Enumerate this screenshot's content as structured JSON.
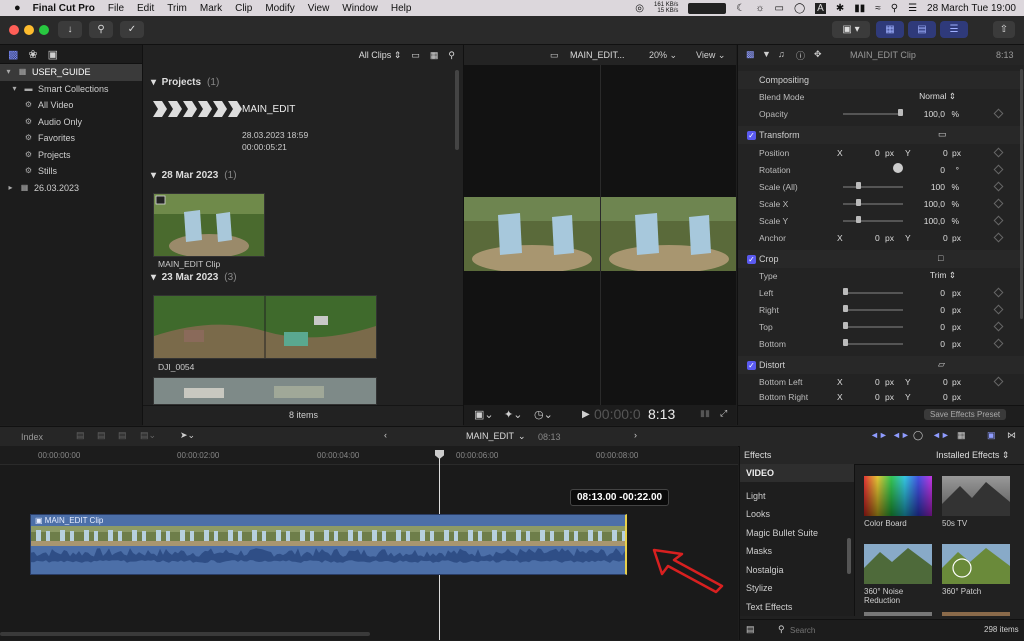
{
  "menubar": {
    "app_name": "Final Cut Pro",
    "menus": [
      "File",
      "Edit",
      "Trim",
      "Mark",
      "Clip",
      "Modify",
      "View",
      "Window",
      "Help"
    ],
    "net_up": "161 KB/s",
    "net_down": "15 KB/s",
    "date_time": "28 March Tue  19:00"
  },
  "library": {
    "items": [
      {
        "label": "USER_GUIDE",
        "icon": "library-icon"
      },
      {
        "label": "Smart Collections",
        "icon": "folder-icon"
      },
      {
        "label": "All Video",
        "icon": "smart-collection-icon"
      },
      {
        "label": "Audio Only",
        "icon": "smart-collection-icon"
      },
      {
        "label": "Favorites",
        "icon": "smart-collection-icon"
      },
      {
        "label": "Projects",
        "icon": "smart-collection-icon"
      },
      {
        "label": "Stills",
        "icon": "smart-collection-icon"
      },
      {
        "label": "26.03.2023",
        "icon": "event-icon"
      }
    ]
  },
  "browser": {
    "filter": "All Clips",
    "sections": [
      {
        "title": "Projects",
        "count": "(1)"
      },
      {
        "title": "28 Mar 2023",
        "count": "(1)"
      },
      {
        "title": "23 Mar 2023",
        "count": "(3)"
      }
    ],
    "project": {
      "name": "MAIN_EDIT",
      "date": "28.03.2023 18:59",
      "duration": "00:00:05:21"
    },
    "clips": [
      {
        "name": "MAIN_EDIT Clip"
      },
      {
        "name": "DJI_0054"
      }
    ],
    "item_count": "8 items"
  },
  "viewer": {
    "title": "MAIN_EDIT...",
    "zoom": "20%",
    "view_label": "View",
    "timecode_dim": "00:00:0",
    "timecode": "8:13"
  },
  "inspector": {
    "clip_name": "MAIN_EDIT Clip",
    "duration": "8:13",
    "compositing": "Compositing",
    "blend_mode_label": "Blend Mode",
    "blend_mode": "Normal",
    "opacity_label": "Opacity",
    "opacity": "100,0",
    "opacity_unit": "%",
    "transform": "Transform",
    "position_label": "Position",
    "rotation_label": "Rotation",
    "rotation": "0",
    "deg": "°",
    "scale_all_label": "Scale (All)",
    "scale_all": "100",
    "scale_x_label": "Scale X",
    "scale_x": "100,0",
    "scale_y_label": "Scale Y",
    "scale_y": "100,0",
    "anchor_label": "Anchor",
    "x": "X",
    "y": "Y",
    "zero": "0",
    "px": "px",
    "pct": "%",
    "crop": "Crop",
    "type_label": "Type",
    "type_value": "Trim",
    "left_label": "Left",
    "right_label": "Right",
    "top_label": "Top",
    "bottom_label": "Bottom",
    "distort": "Distort",
    "bottom_left_label": "Bottom Left",
    "bottom_right_label": "Bottom Right",
    "save_preset": "Save Effects Preset"
  },
  "timeline_bar": {
    "index": "Index",
    "project": "MAIN_EDIT",
    "duration": "08:13"
  },
  "timeline": {
    "ruler": [
      "00:00:00:00",
      "00:00:02:00",
      "00:00:04:00",
      "00:00:06:00",
      "00:00:08:00"
    ],
    "tooltip": "08:13.00  -00:22.00",
    "clip_name": "MAIN_EDIT Clip"
  },
  "effects": {
    "title": "Effects",
    "installed": "Installed Effects",
    "categories": [
      "VIDEO",
      "Light",
      "Looks",
      "Magic Bullet Suite",
      "Masks",
      "Nostalgia",
      "Stylize",
      "Text Effects"
    ],
    "tiles": [
      {
        "name": "Color Board"
      },
      {
        "name": "50s TV"
      },
      {
        "name": "360° Noise Reduction"
      },
      {
        "name": "360° Patch"
      }
    ],
    "search_placeholder": "Search",
    "count": "298 items"
  },
  "colors": {
    "accent": "#5a5af0",
    "clip_blue": "#4c6fa8",
    "arrow_red": "#d82020"
  }
}
